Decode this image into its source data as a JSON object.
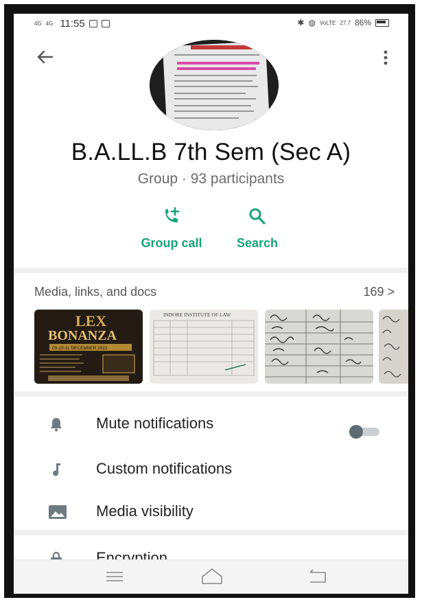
{
  "status_bar": {
    "network_1": "4G",
    "network_2": "4G",
    "time": "11:55",
    "right_info": "VoLTE",
    "speed": "27.7",
    "battery": "86%"
  },
  "group": {
    "name": "B.A.LL.B 7th Sem (Sec A)",
    "subtitle": "Group · 93 participants"
  },
  "actions": [
    {
      "label": "Group call",
      "icon": "add-call-icon"
    },
    {
      "label": "Search",
      "icon": "search-icon"
    }
  ],
  "media": {
    "header": "Media, links, and docs",
    "count": "169 >",
    "thumbnails": [
      {
        "name": "lex-bonanza-poster",
        "text_line1": "LEX",
        "text_line2": "BONANZA",
        "text_line3": "09-10-11 DECEMBER 2022"
      },
      {
        "name": "institute-document",
        "text_line1": "INDORE INSTITUTE OF LAW"
      },
      {
        "name": "handwritten-page"
      },
      {
        "name": "handwritten-page-2"
      }
    ]
  },
  "settings": [
    {
      "label": "Mute notifications",
      "icon": "bell-icon",
      "has_toggle": true
    },
    {
      "label": "Custom notifications",
      "icon": "music-note-icon"
    },
    {
      "label": "Media visibility",
      "icon": "image-icon"
    },
    {
      "label": "Encryption",
      "icon": "lock-icon"
    }
  ],
  "colors": {
    "accent": "#17a37a",
    "toggle_knob": "#5f6b73",
    "toggle_track": "#c9cfd3"
  }
}
